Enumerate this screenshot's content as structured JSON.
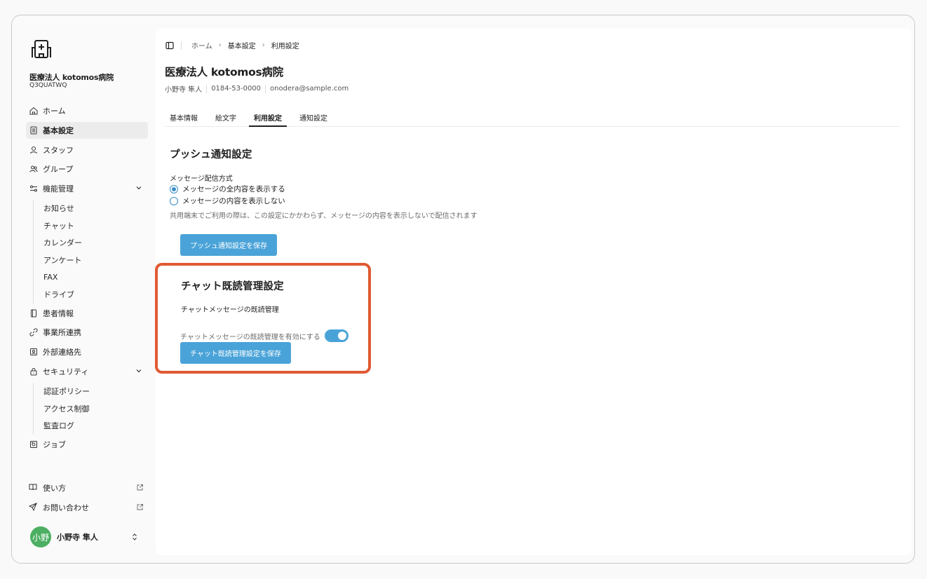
{
  "org": {
    "name": "医療法人 kotomos病院",
    "code": "Q3QUATWQ"
  },
  "nav": {
    "home": "ホーム",
    "basic_settings": "基本設定",
    "staff": "スタッフ",
    "group": "グループ",
    "feature_mgmt": "機能管理",
    "feature_items": [
      "お知らせ",
      "チャット",
      "カレンダー",
      "アンケート",
      "FAX",
      "ドライブ"
    ],
    "patients": "患者情報",
    "office_link": "事業所連携",
    "external_contacts": "外部連絡先",
    "security": "セキュリティ",
    "security_items": [
      "認証ポリシー",
      "アクセス制御",
      "監査ログ"
    ],
    "jobs": "ジョブ"
  },
  "bottom_nav": {
    "how_to": "使い方",
    "contact": "お問い合わせ"
  },
  "user": {
    "avatar_text": "小野",
    "name": "小野寺 隼人"
  },
  "breadcrumb": {
    "home": "ホーム",
    "basic": "基本設定",
    "current": "利用設定"
  },
  "page": {
    "title": "医療法人 kotomos病院",
    "contact_name": "小野寺 隼人",
    "phone": "0184-53-0000",
    "email": "onodera@sample.com"
  },
  "tabs": [
    "基本情報",
    "絵文字",
    "利用設定",
    "通知設定"
  ],
  "push": {
    "title": "プッシュ通知設定",
    "method_label": "メッセージ配信方式",
    "option_all": "メッセージの全内容を表示する",
    "option_hide": "メッセージの内容を表示しない",
    "hint": "共用端末でご利用の際は、この設定にかかわらず、メッセージの内容を表示しないで配信されます",
    "save": "プッシュ通知設定を保存"
  },
  "chat_read": {
    "title": "チャット既読管理設定",
    "label": "チャットメッセージの既読管理",
    "toggle_label": "チャットメッセージの既読管理を有効にする",
    "save": "チャット既読管理設定を保存"
  },
  "colors": {
    "accent": "#4aa3d8",
    "highlight": "#e05a33",
    "avatar": "#4caf62"
  }
}
